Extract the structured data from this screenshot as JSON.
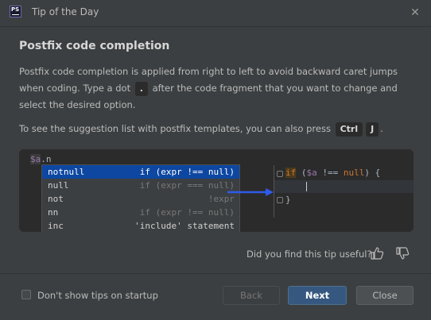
{
  "window": {
    "app_icon_text": "PS",
    "title": "Tip of the Day",
    "close_glyph": "✕"
  },
  "tip": {
    "heading": "Postfix code completion",
    "para1_a": "Postfix code completion is applied from right to left to avoid backward caret jumps when coding. Type a dot",
    "para1_key": ".",
    "para1_b": "after the code fragment that you want to change and select the desired option.",
    "para2_a": "To see the suggestion list with postfix templates, you can also press",
    "para2_key1": "Ctrl",
    "para2_key2": "J",
    "para2_b": "."
  },
  "demo": {
    "typed_var": "$a",
    "typed_suffix": ".n",
    "completions": [
      {
        "key": "notnull",
        "desc": "if (expr !== null)",
        "selected": true
      },
      {
        "key": "null",
        "desc": "if (expr === null)",
        "selected": false
      },
      {
        "key": "not",
        "desc": "!expr",
        "selected": false
      },
      {
        "key": "nn",
        "desc": "if (expr !== null)",
        "selected": false
      },
      {
        "key": "inc",
        "desc": "'include' statement",
        "selected": false
      }
    ],
    "result_kw": "if",
    "result_open": " (",
    "result_var": "$a",
    "result_op": " !== ",
    "result_null": "null",
    "result_close": ") {",
    "result_end": "}",
    "arrow_color": "#2f5bea"
  },
  "feedback": {
    "question": "Did you find this tip useful?",
    "thumb_up_icon": "thumbs-up-icon",
    "thumb_down_icon": "thumbs-down-icon"
  },
  "footer": {
    "checkbox_label": "Don't show tips on startup",
    "checkbox_checked": false,
    "back_label": "Back",
    "next_label": "Next",
    "close_label": "Close"
  }
}
